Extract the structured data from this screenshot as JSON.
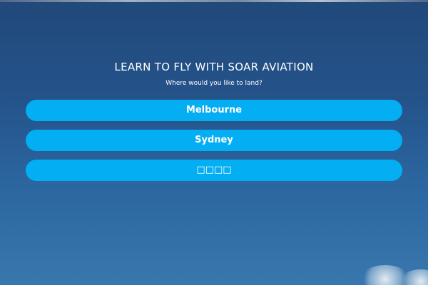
{
  "header": {
    "title": "LEARN TO FLY WITH SOAR AVIATION",
    "subtitle": "Where would you like to land?"
  },
  "locations": [
    {
      "label": "Melbourne"
    },
    {
      "label": "Sydney"
    },
    {
      "label": "□□□□"
    }
  ],
  "colors": {
    "background_top": "#21497a",
    "background_bottom": "#3877ad",
    "button": "#04aef3",
    "text": "#ffffff"
  }
}
